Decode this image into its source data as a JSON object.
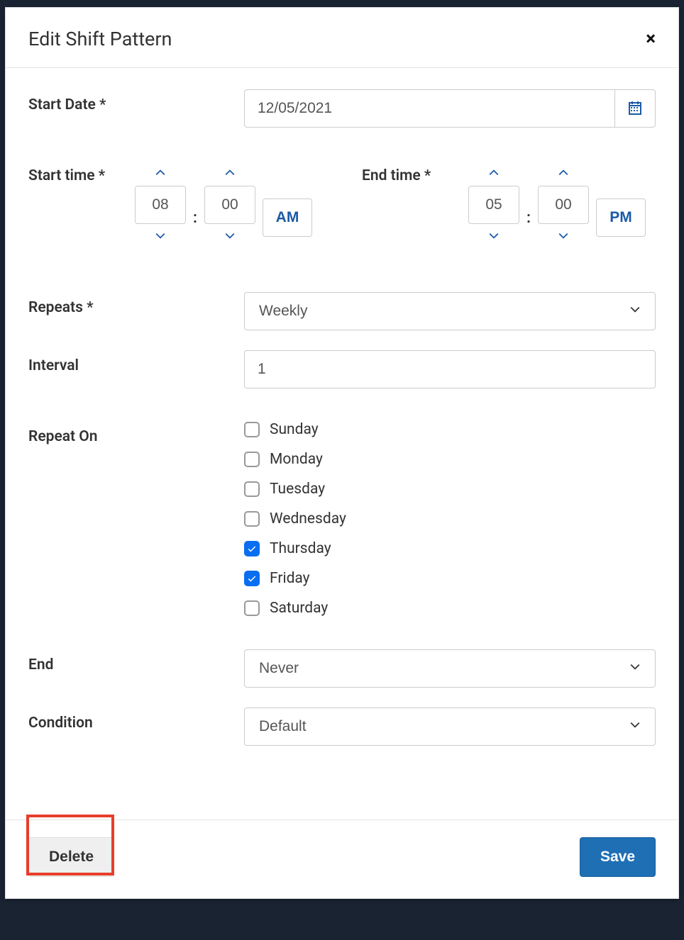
{
  "modal": {
    "title": "Edit Shift Pattern",
    "close_label": "×"
  },
  "fields": {
    "start_date": {
      "label": "Start Date *",
      "value": "12/05/2021"
    },
    "start_time": {
      "label": "Start time *",
      "hour": "08",
      "minute": "00",
      "ampm": "AM"
    },
    "end_time": {
      "label": "End time *",
      "hour": "05",
      "minute": "00",
      "ampm": "PM"
    },
    "repeats": {
      "label": "Repeats *",
      "value": "Weekly"
    },
    "interval": {
      "label": "Interval",
      "value": "1"
    },
    "repeat_on": {
      "label": "Repeat On",
      "days": [
        {
          "label": "Sunday",
          "checked": false
        },
        {
          "label": "Monday",
          "checked": false
        },
        {
          "label": "Tuesday",
          "checked": false
        },
        {
          "label": "Wednesday",
          "checked": false
        },
        {
          "label": "Thursday",
          "checked": true
        },
        {
          "label": "Friday",
          "checked": true
        },
        {
          "label": "Saturday",
          "checked": false
        }
      ]
    },
    "end": {
      "label": "End",
      "value": "Never"
    },
    "condition": {
      "label": "Condition",
      "value": "Default"
    }
  },
  "footer": {
    "delete_label": "Delete",
    "save_label": "Save"
  },
  "time_picker_colon": ":"
}
